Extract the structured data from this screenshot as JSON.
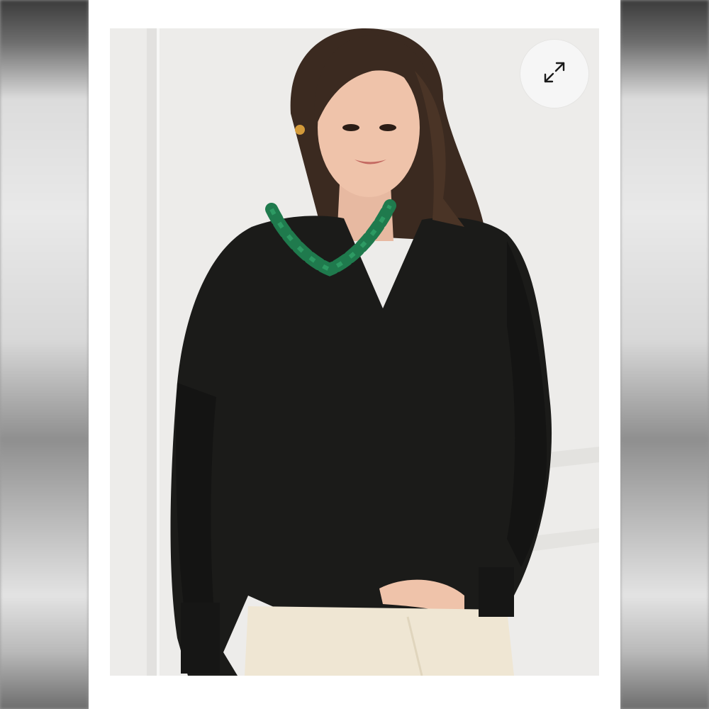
{
  "product_image": {
    "alt": "",
    "expand_icon": "expand-arrows-icon"
  },
  "colors": {
    "card_background": "#ffffff",
    "photo_background": "#ecebe9",
    "sweater": "#1b1b19",
    "necklace": "#1f7a4d",
    "pants": "#efe6d3",
    "button_background": "#f6f6f6"
  }
}
